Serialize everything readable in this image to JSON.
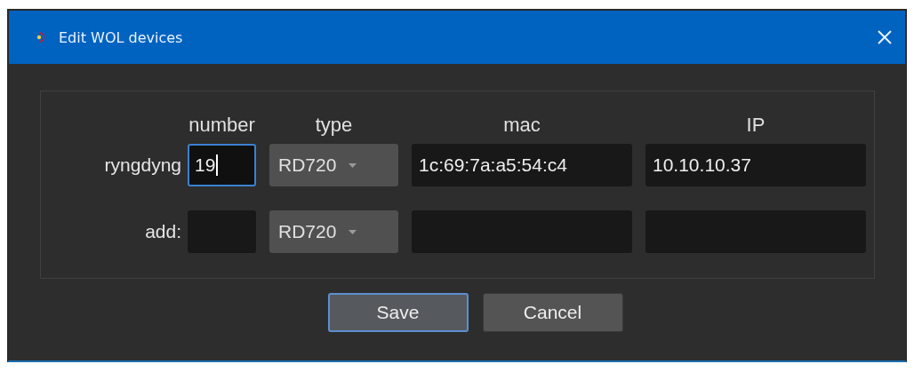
{
  "window": {
    "title": "Edit WOL devices"
  },
  "columns": [
    "number",
    "type",
    "mac",
    "IP"
  ],
  "rows": [
    {
      "label": "ryngdyng",
      "number": {
        "value": "19",
        "focused": true
      },
      "type": "RD720",
      "mac": "1c:69:7a:a5:54:c4",
      "ip": "10.10.10.37"
    },
    {
      "label": "add:",
      "number": {
        "focused": false
      },
      "type": "RD720"
    }
  ],
  "buttons": [
    {
      "label": "Save",
      "default": true
    },
    {
      "label": "Cancel",
      "default": false
    }
  ]
}
